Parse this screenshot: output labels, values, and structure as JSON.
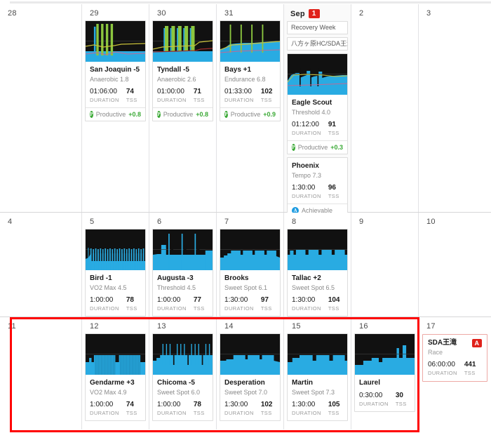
{
  "calendar": {
    "colors": {
      "accent_red": "#e0221b",
      "selection_red": "#ff0000",
      "productive_green": "#3aa935",
      "achievable_blue": "#1b9ae0",
      "graph_blue": "#29ABE2",
      "graph_green": "#8cc63f",
      "graph_bg": "#111111"
    },
    "labels": {
      "duration": "DURATION",
      "tss": "TSS"
    },
    "rows": [
      {
        "days": [
          {
            "num": "28",
            "today": false,
            "chips": [],
            "workouts": []
          },
          {
            "num": "29",
            "today": false,
            "chips": [],
            "workouts": [
              {
                "title": "San Joaquin -5",
                "sub": "Anaerobic 1.8",
                "duration": "01:06:00",
                "tss": "74",
                "status": {
                  "icon": "productive-icon",
                  "label": "Productive",
                  "value": "+0.8",
                  "kind": "p"
                },
                "graph": "spikes-green"
              }
            ]
          },
          {
            "num": "30",
            "today": false,
            "chips": [],
            "workouts": [
              {
                "title": "Tyndall -5",
                "sub": "Anaerobic 2.6",
                "duration": "01:00:00",
                "tss": "71",
                "status": {
                  "icon": "productive-icon",
                  "label": "Productive",
                  "value": "+0.8",
                  "kind": "p"
                },
                "graph": "blocks-green"
              }
            ]
          },
          {
            "num": "31",
            "today": false,
            "chips": [],
            "workouts": [
              {
                "title": "Bays +1",
                "sub": "Endurance 6.8",
                "duration": "01:33:00",
                "tss": "102",
                "status": {
                  "icon": "productive-icon",
                  "label": "Productive",
                  "value": "+0.9",
                  "kind": "p"
                },
                "graph": "endurance-green"
              }
            ]
          },
          {
            "num": "1",
            "month": "Sep",
            "today": true,
            "chips": [
              "Recovery Week",
              "八方ヶ原HC/SDA王滝"
            ],
            "workouts": [
              {
                "title": "Eagle Scout",
                "sub": "Threshold 4.0",
                "duration": "01:12:00",
                "tss": "91",
                "status": {
                  "icon": "productive-icon",
                  "label": "Productive",
                  "value": "+0.3",
                  "kind": "p"
                },
                "graph": "threshold-blue"
              },
              {
                "title": "Phoenix",
                "sub": "Tempo 7.3",
                "duration": "1:30:00",
                "tss": "96",
                "status": {
                  "icon": "achievable-icon",
                  "label": "Achievable",
                  "value": "",
                  "kind": "a"
                },
                "graph": "none"
              }
            ]
          },
          {
            "num": "2",
            "today": false,
            "chips": [],
            "workouts": []
          },
          {
            "num": "3",
            "today": false,
            "chips": [],
            "workouts": []
          }
        ]
      },
      {
        "days": [
          {
            "num": "4",
            "today": false,
            "chips": [],
            "workouts": []
          },
          {
            "num": "5",
            "today": false,
            "chips": [],
            "workouts": [
              {
                "title": "Bird -1",
                "sub": "VO2 Max 4.5",
                "duration": "1:00:00",
                "tss": "78",
                "graph": "vo2-comb"
              }
            ]
          },
          {
            "num": "6",
            "today": false,
            "chips": [],
            "workouts": [
              {
                "title": "Augusta -3",
                "sub": "Threshold 4.5",
                "duration": "1:00:00",
                "tss": "77",
                "graph": "threshold-spikes"
              }
            ]
          },
          {
            "num": "7",
            "today": false,
            "chips": [],
            "workouts": [
              {
                "title": "Brooks",
                "sub": "Sweet Spot 6.1",
                "duration": "1:30:00",
                "tss": "97",
                "graph": "sweetspot"
              }
            ]
          },
          {
            "num": "8",
            "today": false,
            "chips": [],
            "workouts": [
              {
                "title": "Tallac +2",
                "sub": "Sweet Spot 6.5",
                "duration": "1:30:00",
                "tss": "104",
                "graph": "sweetspot2"
              }
            ]
          },
          {
            "num": "9",
            "today": false,
            "chips": [],
            "workouts": []
          },
          {
            "num": "10",
            "today": false,
            "chips": [],
            "workouts": []
          }
        ]
      },
      {
        "days": [
          {
            "num": "11",
            "today": false,
            "chips": [],
            "workouts": []
          },
          {
            "num": "12",
            "today": false,
            "chips": [],
            "workouts": [
              {
                "title": "Gendarme +3",
                "sub": "VO2 Max 4.9",
                "duration": "1:00:00",
                "tss": "74",
                "graph": "gendarme"
              }
            ]
          },
          {
            "num": "13",
            "today": false,
            "chips": [],
            "workouts": [
              {
                "title": "Chicoma -5",
                "sub": "Sweet Spot 6.0",
                "duration": "1:00:00",
                "tss": "78",
                "graph": "chicoma"
              }
            ]
          },
          {
            "num": "14",
            "today": false,
            "chips": [],
            "workouts": [
              {
                "title": "Desperation",
                "sub": "Sweet Spot 7.0",
                "duration": "1:30:00",
                "tss": "102",
                "graph": "desperation"
              }
            ]
          },
          {
            "num": "15",
            "today": false,
            "chips": [],
            "workouts": [
              {
                "title": "Martin",
                "sub": "Sweet Spot 7.3",
                "duration": "1:30:00",
                "tss": "105",
                "graph": "martin"
              }
            ]
          },
          {
            "num": "16",
            "today": false,
            "chips": [],
            "workouts": [
              {
                "title": "Laurel",
                "sub": "",
                "duration": "0:30:00",
                "tss": "30",
                "graph": "laurel"
              }
            ]
          },
          {
            "num": "17",
            "today": false,
            "chips": [],
            "workouts": [],
            "race": {
              "title": "SDA王滝",
              "badge": "A",
              "sub": "Race",
              "duration": "06:00:00",
              "tss": "441"
            }
          }
        ]
      }
    ]
  }
}
